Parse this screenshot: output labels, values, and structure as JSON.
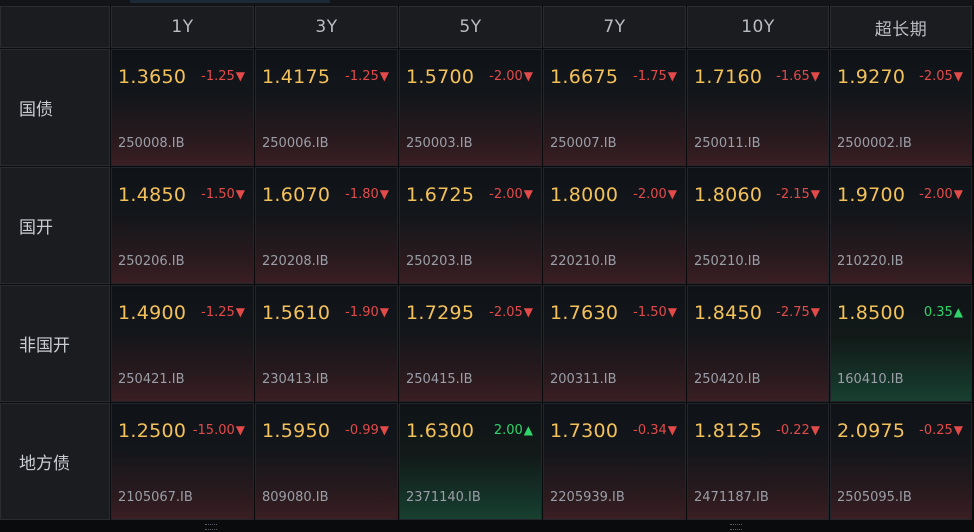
{
  "columns": [
    "1Y",
    "3Y",
    "5Y",
    "7Y",
    "10Y",
    "超长期"
  ],
  "rows": [
    {
      "label": "国债",
      "cells": [
        {
          "yield": "1.3650",
          "change": "-1.25",
          "dir": "down",
          "code": "250008.IB"
        },
        {
          "yield": "1.4175",
          "change": "-1.25",
          "dir": "down",
          "code": "250006.IB"
        },
        {
          "yield": "1.5700",
          "change": "-2.00",
          "dir": "down",
          "code": "250003.IB"
        },
        {
          "yield": "1.6675",
          "change": "-1.75",
          "dir": "down",
          "code": "250007.IB"
        },
        {
          "yield": "1.7160",
          "change": "-1.65",
          "dir": "down",
          "code": "250011.IB"
        },
        {
          "yield": "1.9270",
          "change": "-2.05",
          "dir": "down",
          "code": "2500002.IB"
        }
      ]
    },
    {
      "label": "国开",
      "cells": [
        {
          "yield": "1.4850",
          "change": "-1.50",
          "dir": "down",
          "code": "250206.IB"
        },
        {
          "yield": "1.6070",
          "change": "-1.80",
          "dir": "down",
          "code": "220208.IB"
        },
        {
          "yield": "1.6725",
          "change": "-2.00",
          "dir": "down",
          "code": "250203.IB"
        },
        {
          "yield": "1.8000",
          "change": "-2.00",
          "dir": "down",
          "code": "220210.IB"
        },
        {
          "yield": "1.8060",
          "change": "-2.15",
          "dir": "down",
          "code": "250210.IB"
        },
        {
          "yield": "1.9700",
          "change": "-2.00",
          "dir": "down",
          "code": "210220.IB"
        }
      ]
    },
    {
      "label": "非国开",
      "cells": [
        {
          "yield": "1.4900",
          "change": "-1.25",
          "dir": "down",
          "code": "250421.IB"
        },
        {
          "yield": "1.5610",
          "change": "-1.90",
          "dir": "down",
          "code": "230413.IB"
        },
        {
          "yield": "1.7295",
          "change": "-2.05",
          "dir": "down",
          "code": "250415.IB"
        },
        {
          "yield": "1.7630",
          "change": "-1.50",
          "dir": "down",
          "code": "200311.IB"
        },
        {
          "yield": "1.8450",
          "change": "-2.75",
          "dir": "down",
          "code": "250420.IB"
        },
        {
          "yield": "1.8500",
          "change": "0.35",
          "dir": "up",
          "code": "160410.IB"
        }
      ]
    },
    {
      "label": "地方债",
      "cells": [
        {
          "yield": "1.2500",
          "change": "-15.00",
          "dir": "down",
          "code": "2105067.IB"
        },
        {
          "yield": "1.5950",
          "change": "-0.99",
          "dir": "down",
          "code": "809080.IB"
        },
        {
          "yield": "1.6300",
          "change": "2.00",
          "dir": "up",
          "code": "2371140.IB"
        },
        {
          "yield": "1.7300",
          "change": "-0.34",
          "dir": "down",
          "code": "2205939.IB"
        },
        {
          "yield": "1.8125",
          "change": "-0.22",
          "dir": "down",
          "code": "2471187.IB"
        },
        {
          "yield": "2.0975",
          "change": "-0.25",
          "dir": "down",
          "code": "2505095.IB"
        }
      ]
    }
  ],
  "icons": {
    "down": "triangle-down-icon",
    "up": "triangle-up-icon"
  },
  "colors": {
    "yield": "#f3c15a",
    "down": "#e34a4a",
    "up": "#2fd46b"
  }
}
